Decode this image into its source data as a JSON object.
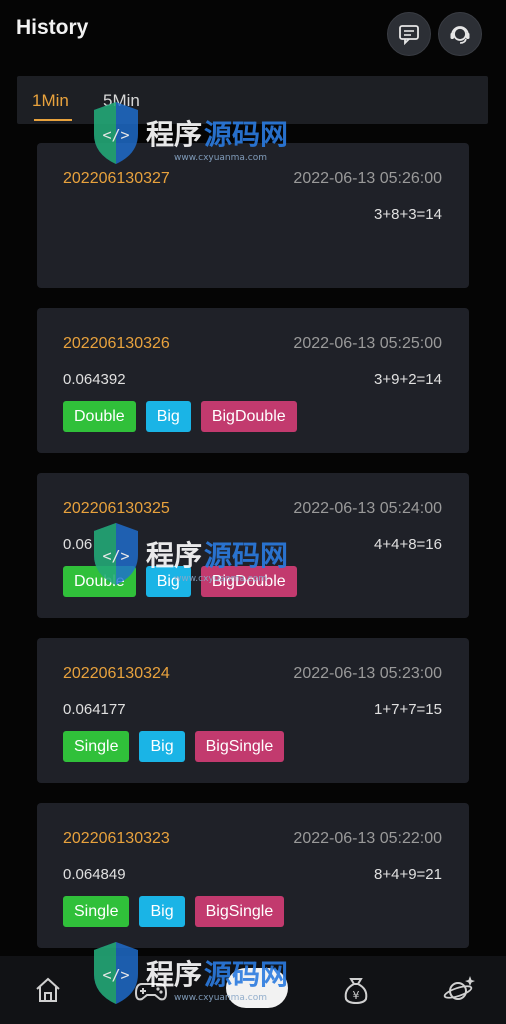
{
  "header": {
    "title": "History",
    "icons": [
      "message-icon",
      "customer-service-icon"
    ]
  },
  "tabs": [
    {
      "label": "1Min",
      "active": true
    },
    {
      "label": "5Min",
      "active": false
    }
  ],
  "records": [
    {
      "period": "202206130327",
      "time": "2022-06-13 05:26:00",
      "hash": "",
      "sum": "3+8+3=14",
      "tags": []
    },
    {
      "period": "202206130326",
      "time": "2022-06-13 05:25:00",
      "hash": "0.064392",
      "sum": "3+9+2=14",
      "tags": [
        "Double",
        "Big",
        "BigDouble"
      ]
    },
    {
      "period": "202206130325",
      "time": "2022-06-13 05:24:00",
      "hash": "0.06",
      "sum": "4+4+8=16",
      "tags": [
        "Double",
        "Big",
        "BigDouble"
      ]
    },
    {
      "period": "202206130324",
      "time": "2022-06-13 05:23:00",
      "hash": "0.064177",
      "sum": "1+7+7=15",
      "tags": [
        "Single",
        "Big",
        "BigSingle"
      ]
    },
    {
      "period": "202206130323",
      "time": "2022-06-13 05:22:00",
      "hash": "0.064849",
      "sum": "8+4+9=21",
      "tags": [
        "Single",
        "Big",
        "BigSingle"
      ]
    }
  ],
  "tag_colors": {
    "Double": "#30c03a",
    "Single": "#30c03a",
    "Big": "#1ab4e6",
    "BigDouble": "#c23a6e",
    "BigSingle": "#c23a6e"
  },
  "watermark": {
    "text": "程序源码网",
    "url": "www.cxyuanma.com"
  },
  "nav": [
    "home-icon",
    "gamepad-icon",
    "center-button",
    "money-bag-icon",
    "planet-icon"
  ]
}
